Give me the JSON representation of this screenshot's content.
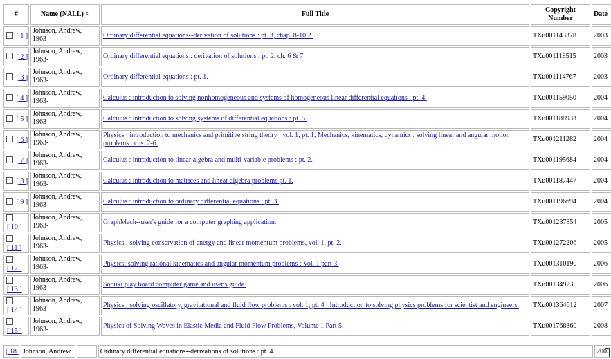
{
  "columns": {
    "num": "#",
    "name": "Name (NALL) <",
    "title": "Full Title",
    "copyright": "Copyright Number",
    "date": "Date"
  },
  "records": [
    {
      "num": "[ 1 ]",
      "name1": "Johnson, Andrew,",
      "name2": "1963-",
      "title": "Ordinary differential equations--derivation of solutions : pt. 3, chap. 8-10.2.",
      "copyright": "TXu001143378",
      "date": "2003"
    },
    {
      "num": "[ 2 ]",
      "name1": "Johnson, Andrew,",
      "name2": "1963-",
      "title": "Ordinary differential equations : derivation of solutions : pt. 2, ch. 6 & 7.",
      "copyright": "TXu001119515",
      "date": "2003"
    },
    {
      "num": "[ 3 ]",
      "name1": "Johnson, Andrew,",
      "name2": "1963-",
      "title": "Ordinary differential equations : pt. 1.",
      "copyright": "TXu001114767",
      "date": "2003"
    },
    {
      "num": "[ 4 ]",
      "name1": "Johnson, Andrew,",
      "name2": "1963-",
      "title": "Calculus : introduction to solving nonhomogeneous and systems of homogeneous linear differential equations : pt. 4.",
      "copyright": "TXu001159050",
      "date": "2004"
    },
    {
      "num": "[ 5 ]",
      "name1": "Johnson, Andrew,",
      "name2": "1963-",
      "title": "Calculus : introduction to solving systems of differential equations : pt. 5.",
      "copyright": "TXu001188933",
      "date": "2004"
    },
    {
      "num": "[ 6 ]",
      "name1": "Johnson, Andrew,",
      "name2": "1963-",
      "title": "Physics : introduction to mechanics and primitive string theory : vol. 1, pt. 1, Mechanics, kinematics, dynamics : solving linear and angular motion problems : chs. 2-6.",
      "copyright": "TXu001211282",
      "date": "2004"
    },
    {
      "num": "[ 7 ]",
      "name1": "Johnson, Andrew,",
      "name2": "1963-",
      "title": "Calculus : introduction to linear algebra and multi-variable problems : pt. 2.",
      "copyright": "TXu001195684",
      "date": "2004"
    },
    {
      "num": "[ 8 ]",
      "name1": "Johnson, Andrew,",
      "name2": "1963-",
      "title": "Calculus : introduction to matrices and linear algebra problems pt. 1.",
      "copyright": "TXu001187447",
      "date": "2004"
    },
    {
      "num": "[ 9 ]",
      "name1": "Johnson, Andrew,",
      "name2": "1963-",
      "title": "Calculus : introduction to ordinary differential equations : pt. 3.",
      "copyright": "TXu001196694",
      "date": "2004"
    },
    {
      "num": "[ 10 ]",
      "name1": "Johnson, Andrew,",
      "name2": "1963-",
      "title": "GraphMach--user's guide for a computer graphing application.",
      "copyright": "TXu001237854",
      "date": "2005"
    },
    {
      "num": "[ 11 ]",
      "name1": "Johnson, Andrew,",
      "name2": "1963-",
      "title": "Physics : solving conservation of energy and linear momentum problems, vol. 1, pt. 2.",
      "copyright": "TXu001272206",
      "date": "2005"
    },
    {
      "num": "[ 12 ]",
      "name1": "Johnson, Andrew,",
      "name2": "1963-",
      "title": "Physics: solving rational kinematics and angular momentum problems : Vol. 1 part 3.",
      "copyright": "TXu001310190",
      "date": "2006"
    },
    {
      "num": "[ 13 ]",
      "name1": "Johnson, Andrew,",
      "name2": "1963-",
      "title": "Soduki play board computer game and user's guide.",
      "copyright": "TXu001349235",
      "date": "2006"
    },
    {
      "num": "[ 14 ]",
      "name1": "Johnson, Andrew,",
      "name2": "1963-",
      "title": "Physics : solving oscillatory, gravitational and fluid flow problems : vol. 1, pt. 4 : Introduction to solving physics problems for scientist and engineers.",
      "copyright": "TXu001364612",
      "date": "2007"
    },
    {
      "num": "[ 15 ]",
      "name1": "Johnson, Andrew,",
      "name2": "1963-",
      "title": "Physics of Solving Waves in Elastic Media and Fluid Flow Problems, Volume 1 Part 5.",
      "copyright": "TXu001768360",
      "date": "2008"
    }
  ],
  "partial_row": {
    "num": "[ 18 ]",
    "num_cell": "18",
    "name": "Johnson, Andrew",
    "title": "Ordinary differential equations--derivations of solutions : pt. 4.",
    "date": "2003"
  }
}
